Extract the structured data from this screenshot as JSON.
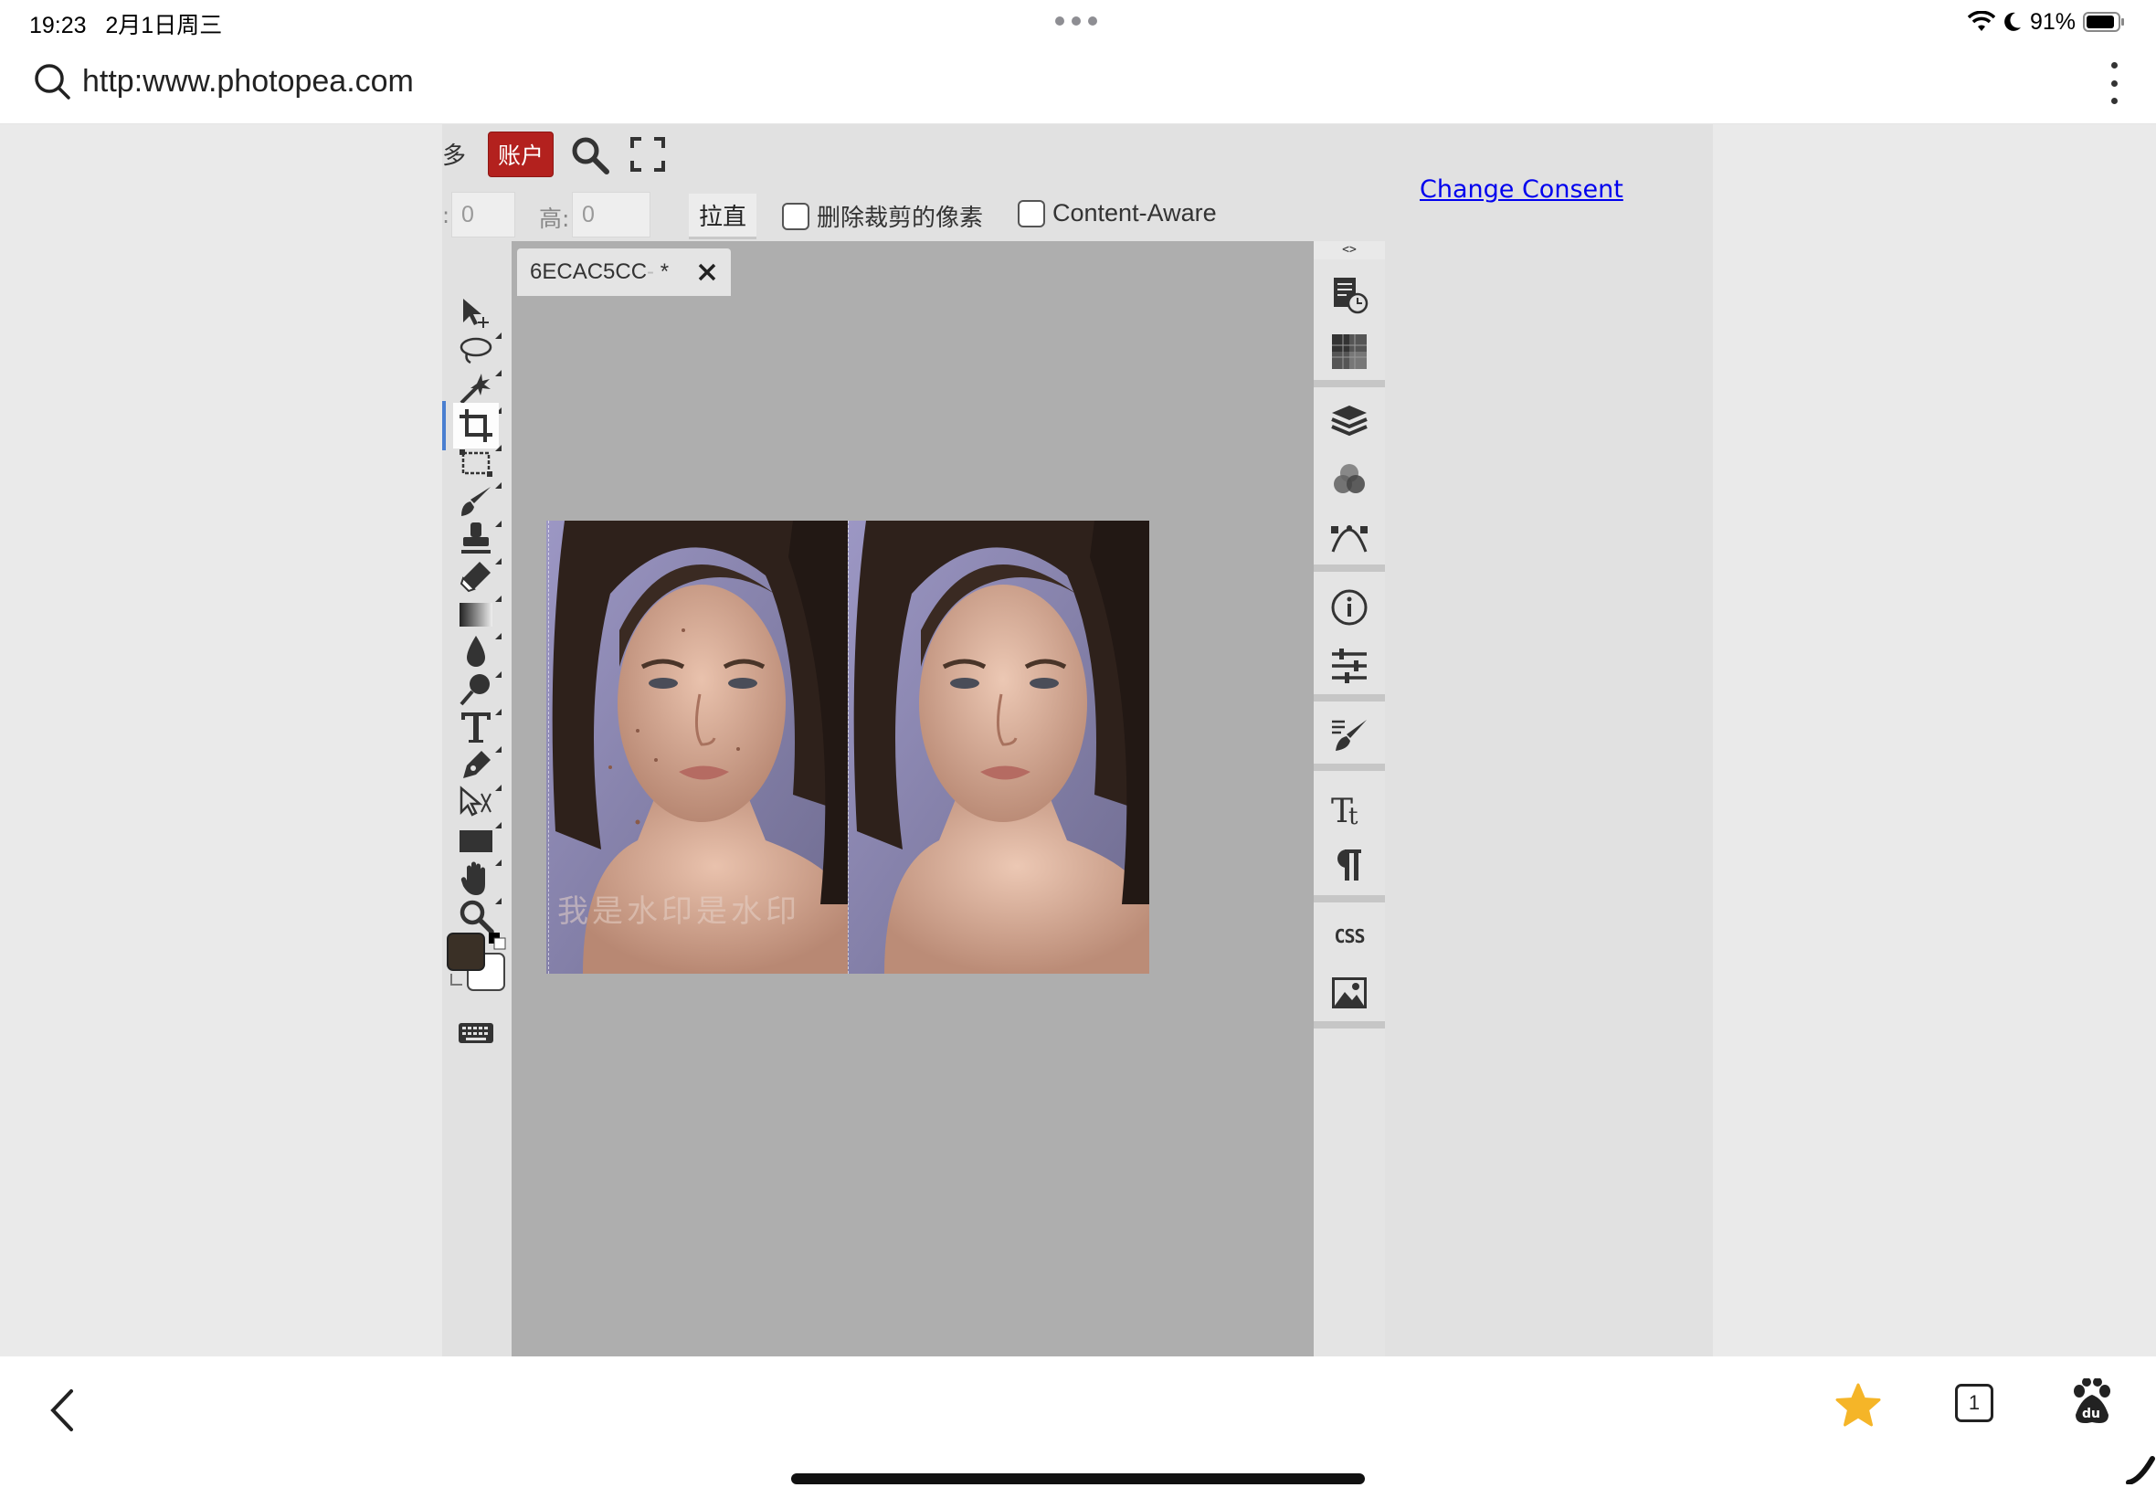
{
  "status_bar": {
    "time": "19:23",
    "date": "2月1日周三",
    "battery_percent": "91%",
    "battery_level": 0.91
  },
  "browser": {
    "url": "http:www.photopea.com",
    "tab_count": "1"
  },
  "photopea": {
    "menu": {
      "more_label": "多",
      "account_label": "账户"
    },
    "options": {
      "width_value": "0",
      "height_label": "高:",
      "height_value": "0",
      "straighten_label": "拉直",
      "delete_cropped_label": "删除裁剪的像素",
      "content_aware_label": "Content-Aware"
    },
    "change_consent": "Change Consent",
    "document_tab": {
      "title": "6ECAC5CC",
      "modified_mark": "*"
    },
    "watermark_text": "我是水印是水印",
    "panel_collapse_label": "<>",
    "css_label": "CSS"
  },
  "colors": {
    "accent_active_tool": "#4a7fd0",
    "account_button": "#b3211e",
    "foreground_color": "#3a3026",
    "background_color": "#ffffff",
    "link": "#0000ee",
    "star": "#f5b528"
  }
}
